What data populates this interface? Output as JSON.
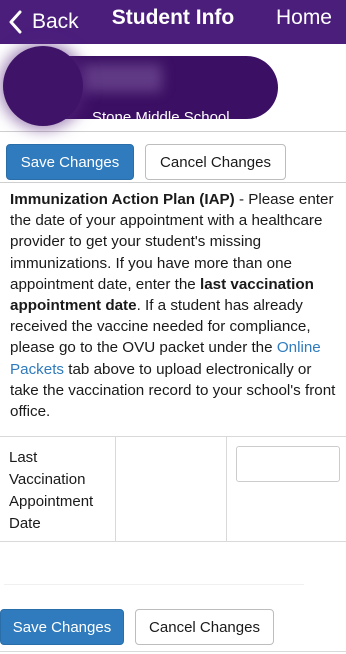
{
  "nav": {
    "back_label": "Back",
    "title": "Student Info",
    "home_label": "Home",
    "color": "#4b1e7c"
  },
  "student": {
    "school": "Stone Middle School"
  },
  "actions": {
    "save_label": "Save Changes",
    "cancel_label": "Cancel Changes",
    "save_color": "#2f7bbd"
  },
  "info": {
    "heading": "Immunization Action Plan (IAP)",
    "text_1": " - Please enter the date of your appointment with a healthcare provider to get your student's missing immunizations. If you have more than one appointment date, enter the ",
    "bold_2": "last vaccination appointment date",
    "text_3": ". If a student has already received the vaccine needed for compliance, please go to the OVU packet under the ",
    "link": "Online Packets",
    "text_4": " tab above to upload electronically or take the vaccination record to your school's front office."
  },
  "form": {
    "field_label": "Last Vaccination Appointment Date",
    "field_value": ""
  }
}
